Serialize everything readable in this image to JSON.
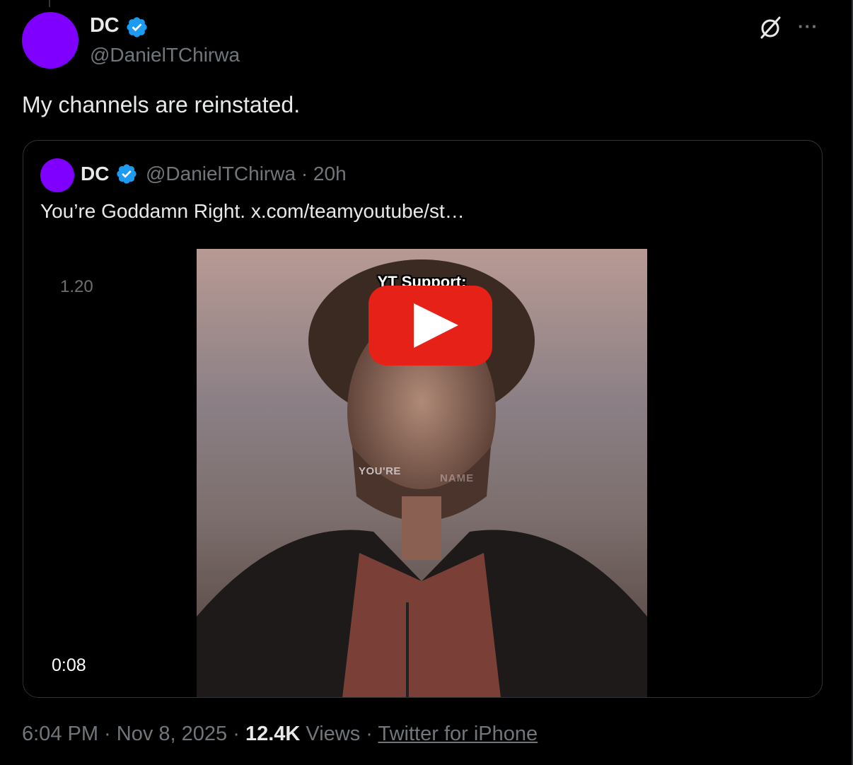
{
  "tweet": {
    "author": {
      "display_name": "DC",
      "handle": "@DanielTChirwa",
      "avatar_color": "#7f00ff",
      "verified": true
    },
    "text": "My channels are reinstated.",
    "icons": {
      "grok": "grok-icon",
      "more": "more-icon"
    },
    "more_label": "···"
  },
  "quote": {
    "author": {
      "display_name": "DC",
      "handle": "@DanielTChirwa",
      "verified": true
    },
    "time_ago": "20h",
    "meta": "@DanielTChirwa · 20h",
    "text": "You’re Goddamn Right.  x.com/teamyoutube/st…",
    "media": {
      "overlay_number": "1.20",
      "duration": "0:08",
      "caption": "YT Support:",
      "subtitle_left": "YOU'RE",
      "subtitle_right": "NAME"
    }
  },
  "footer": {
    "time": "6:04 PM",
    "date": "Nov 8, 2025",
    "views_count": "12.4K",
    "views_label": "Views",
    "source": "Twitter for iPhone",
    "separator": " · "
  },
  "colors": {
    "background": "#000000",
    "text_primary": "#e7e9ea",
    "text_secondary": "#71767b",
    "verified_blue": "#1d9bf0",
    "border": "#2f3336",
    "youtube_red": "#e62117"
  }
}
